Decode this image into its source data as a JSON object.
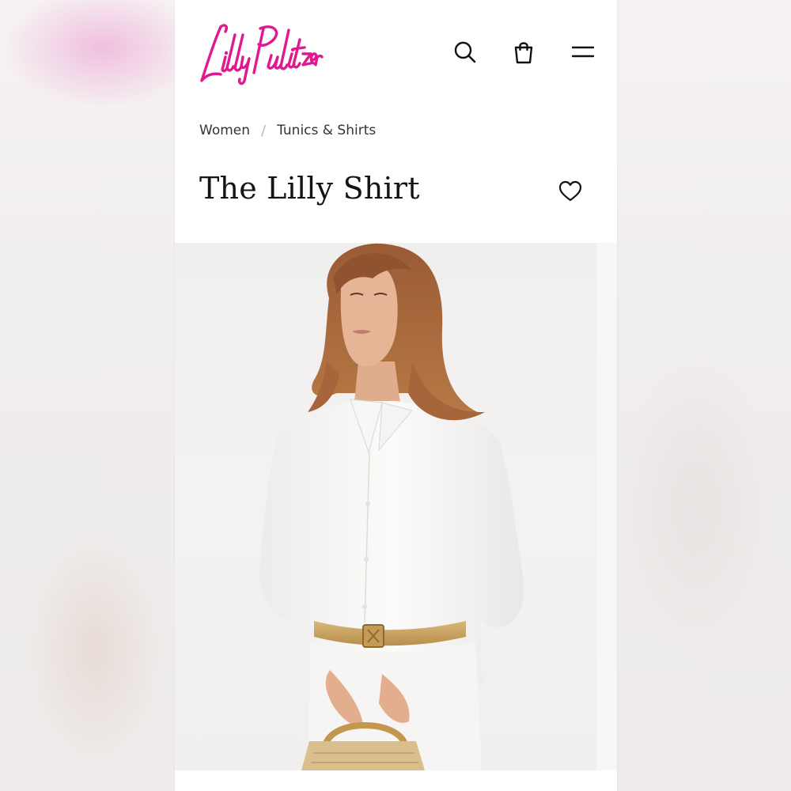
{
  "brand": {
    "logo_text": "Lilly Pulitzer",
    "logo_color": "#e0198f"
  },
  "header": {
    "icons": [
      "search-icon",
      "shopping-bag-icon",
      "menu-icon"
    ]
  },
  "breadcrumb": {
    "items": [
      "Women",
      "Tunics & Shirts"
    ],
    "separator": "/"
  },
  "product": {
    "title": "The Lilly Shirt",
    "wishlist_icon": "heart-icon",
    "image_description": "model-white-button-down-shirt"
  },
  "colors": {
    "background": "#ffffff",
    "text": "#141414",
    "accent": "#e0198f"
  }
}
